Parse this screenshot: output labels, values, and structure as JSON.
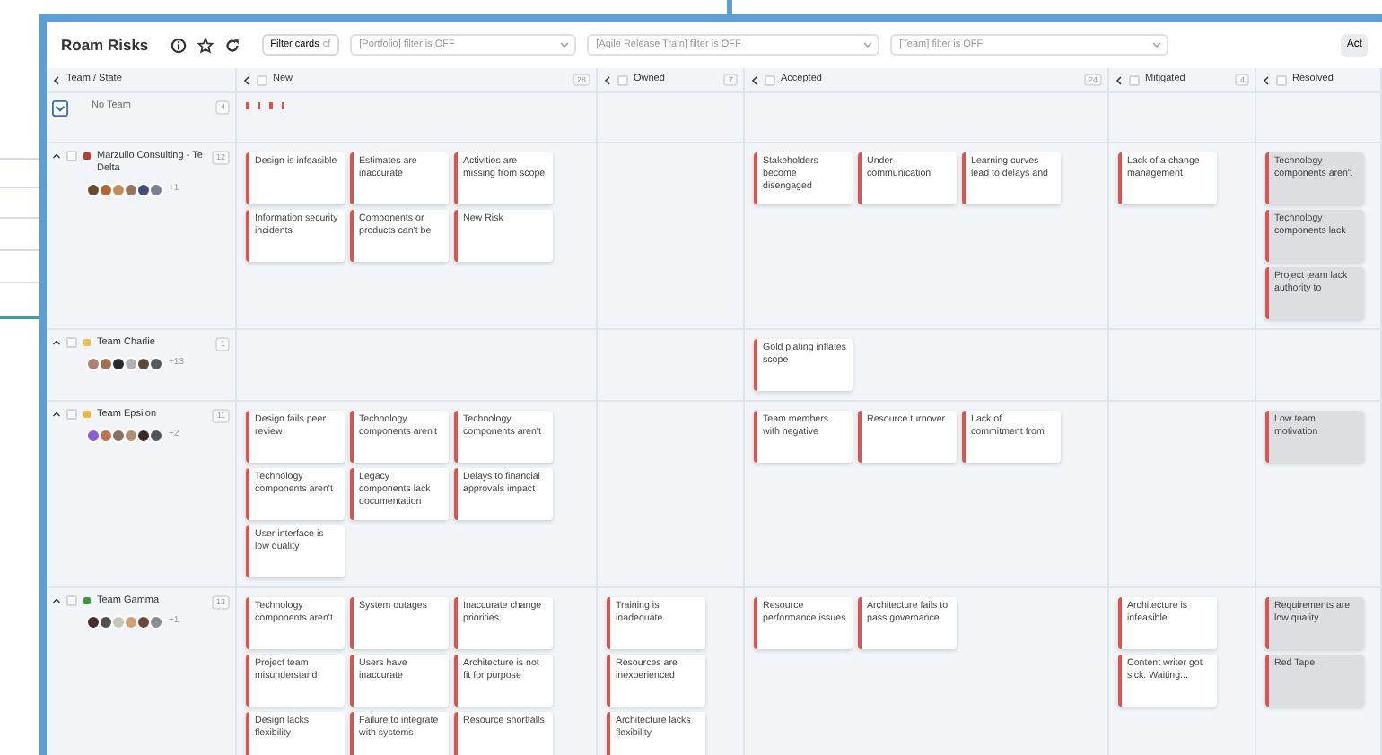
{
  "toolbar": {
    "title": "Roam Risks",
    "filter_button": {
      "label": "Filter cards",
      "hint": "cf"
    },
    "filters": [
      {
        "placeholder": "[Portfolio] filter is OFF"
      },
      {
        "placeholder": "[Agile Release Train] filter is OFF"
      },
      {
        "placeholder": "[Team] filter is OFF"
      }
    ],
    "action_button": "Act"
  },
  "columns": [
    {
      "label": "Team / State"
    },
    {
      "label": "New",
      "count": "28",
      "checked": false
    },
    {
      "label": "Owned",
      "count": "7",
      "checked": false
    },
    {
      "label": "Accepted",
      "count": "24",
      "checked": false
    },
    {
      "label": "Mitigated",
      "count": "4",
      "checked": false
    },
    {
      "label": "Resolved",
      "checked": false
    }
  ],
  "no_team": {
    "name": "No Team",
    "count": "4",
    "expanded": false,
    "markers": [
      {
        "color": "#d9534f"
      },
      {
        "color": "#d9534f"
      },
      {
        "color": "#d9534f"
      },
      {
        "color": "#d9534f"
      }
    ]
  },
  "teams": [
    {
      "name": "Marzullo Consulting - Te Delta",
      "count": "12",
      "checked": false,
      "color": "#c0392b",
      "avatars": [
        {
          "color": "#6b4a2b"
        },
        {
          "color": "#b5652c"
        },
        {
          "color": "#c98a5a"
        },
        {
          "color": "#a0715a"
        },
        {
          "color": "#3f4e7a"
        },
        {
          "color": "#7a8090"
        }
      ],
      "more": "+1",
      "cells": [
        [
          {
            "text": "Design is infeasible",
            "kind": "open"
          },
          {
            "text": "Estimates are inaccurate",
            "kind": "open"
          },
          {
            "text": "Activities are missing from scope",
            "kind": "open"
          },
          {
            "text": "Information security incidents",
            "kind": "open"
          },
          {
            "text": "Components or products can't be",
            "kind": "open"
          },
          {
            "text": "New Risk",
            "kind": "open"
          }
        ],
        [],
        [
          {
            "text": "Stakeholders become disengaged",
            "kind": "open"
          },
          {
            "text": "Under communication",
            "kind": "open"
          },
          {
            "text": "Learning curves lead to delays and",
            "kind": "open"
          }
        ],
        [
          {
            "text": "Lack of a change management",
            "kind": "open"
          }
        ],
        [
          {
            "text": "Technology components aren't",
            "kind": "closed"
          },
          {
            "text": "Technology components lack",
            "kind": "closed"
          },
          {
            "text": "Project team lack authority to",
            "kind": "closed"
          }
        ]
      ]
    },
    {
      "name": "Team Charlie",
      "count": "1",
      "checked": false,
      "color": "#f0c040",
      "avatars": [
        {
          "color": "#b08070"
        },
        {
          "color": "#a07050"
        },
        {
          "color": "#2a2a2a"
        },
        {
          "color": "#b0b0b0"
        },
        {
          "color": "#5a4a3a"
        },
        {
          "color": "#555a60"
        }
      ],
      "more": "+13",
      "cells": [
        [],
        [],
        [
          {
            "text": "Gold plating inflates scope",
            "kind": "open"
          }
        ],
        [],
        []
      ]
    },
    {
      "name": "Team Epsilon",
      "count": "11",
      "checked": false,
      "color": "#f2b632",
      "avatars": [
        {
          "color": "#8a5bd6"
        },
        {
          "color": "#c07050"
        },
        {
          "color": "#8a7060"
        },
        {
          "color": "#b09070"
        },
        {
          "color": "#3a2a20"
        },
        {
          "color": "#50555c"
        }
      ],
      "more": "+2",
      "cells": [
        [
          {
            "text": "Design fails peer review",
            "kind": "open"
          },
          {
            "text": "Technology components aren't",
            "kind": "open"
          },
          {
            "text": "Technology components aren't",
            "kind": "open"
          },
          {
            "text": "Technology components aren't",
            "kind": "open"
          },
          {
            "text": "Legacy components lack documentation",
            "kind": "open"
          },
          {
            "text": "Delays to financial approvals impact",
            "kind": "open"
          },
          {
            "text": "User interface is low quality",
            "kind": "open"
          }
        ],
        [],
        [
          {
            "text": "Team members with negative",
            "kind": "open"
          },
          {
            "text": "Resource turnover",
            "kind": "open"
          },
          {
            "text": "Lack of commitment from",
            "kind": "open"
          }
        ],
        [],
        [
          {
            "text": "Low team motivation",
            "kind": "closed"
          }
        ]
      ]
    },
    {
      "name": "Team Gamma",
      "count": "13",
      "checked": false,
      "color": "#3a9a3a",
      "avatars": [
        {
          "color": "#4a2a2a"
        },
        {
          "color": "#505050"
        },
        {
          "color": "#c8c8b0"
        },
        {
          "color": "#d8a070"
        },
        {
          "color": "#6a4a3a"
        },
        {
          "color": "#8a8f96"
        }
      ],
      "more": "+1",
      "cells": [
        [
          {
            "text": "Technology components aren't",
            "kind": "open"
          },
          {
            "text": "System outages",
            "kind": "open"
          },
          {
            "text": "Inaccurate change priorities",
            "kind": "open"
          },
          {
            "text": "Project team misunderstand",
            "kind": "open"
          },
          {
            "text": "Users have inaccurate",
            "kind": "open"
          },
          {
            "text": "Architecture is not fit for purpose",
            "kind": "open"
          },
          {
            "text": "Design lacks flexibility",
            "kind": "open"
          },
          {
            "text": "Failure to integrate with systems",
            "kind": "open"
          },
          {
            "text": "Resource shortfalls",
            "kind": "open"
          }
        ],
        [
          {
            "text": "Training is inadequate",
            "kind": "open"
          },
          {
            "text": "Resources are inexperienced",
            "kind": "open"
          },
          {
            "text": "Architecture lacks flexibility",
            "kind": "open"
          }
        ],
        [
          {
            "text": "Resource performance issues",
            "kind": "open"
          },
          {
            "text": "Architecture fails to pass governance",
            "kind": "open"
          }
        ],
        [
          {
            "text": "Architecture is infeasible",
            "kind": "open"
          },
          {
            "text": "Content writer got sick. Waiting...",
            "kind": "open"
          }
        ],
        [
          {
            "text": "Requirements are low quality",
            "kind": "closed"
          },
          {
            "text": "Red Tape",
            "kind": "closed"
          }
        ]
      ]
    }
  ]
}
